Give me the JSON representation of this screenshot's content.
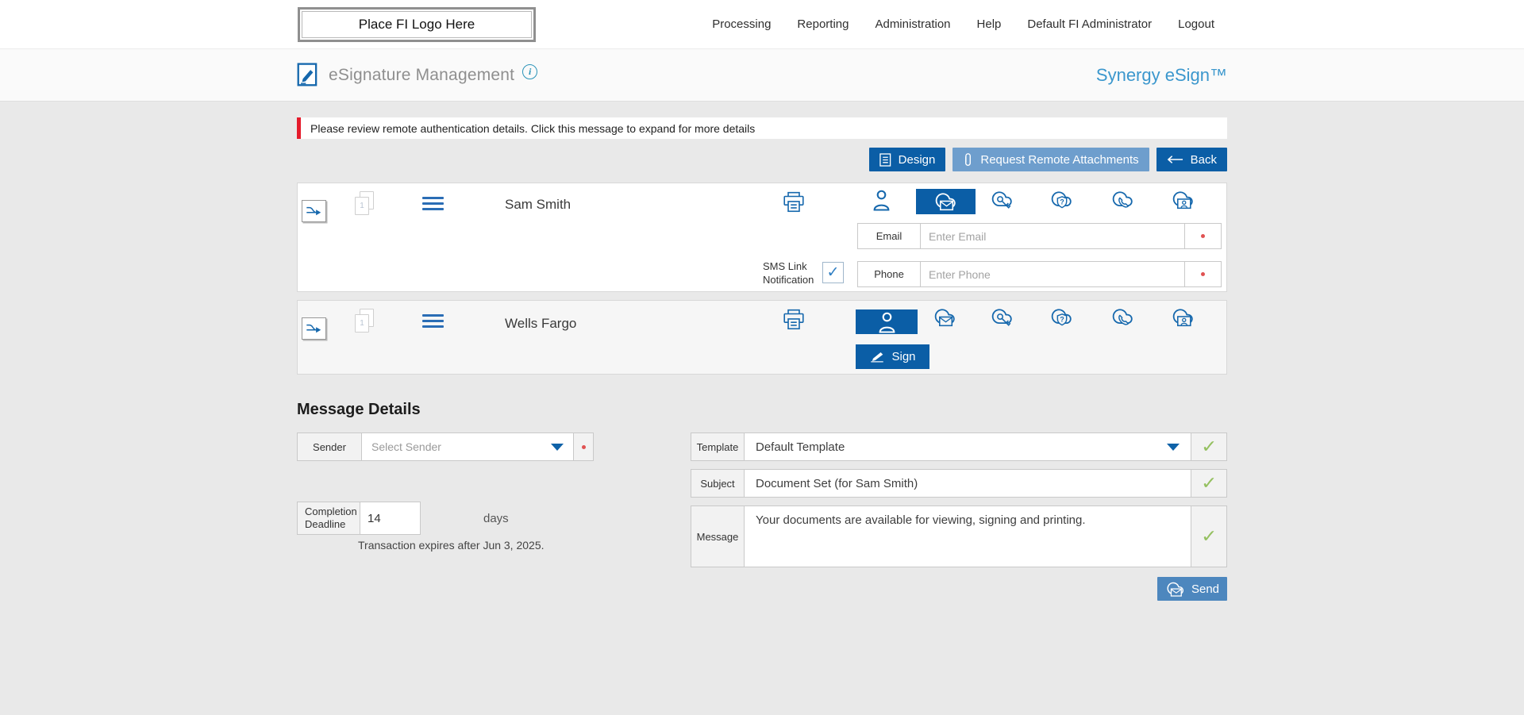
{
  "topnav": {
    "logo_text": "Place FI Logo Here",
    "items": [
      "Processing",
      "Reporting",
      "Administration",
      "Help",
      "Default FI Administrator",
      "Logout"
    ]
  },
  "header": {
    "title": "eSignature Management",
    "brand": "Synergy eSign™"
  },
  "alert": {
    "text": "Please review remote authentication details. Click this message to expand for more details"
  },
  "toolbar": {
    "design_label": "Design",
    "request_label": "Request Remote Attachments",
    "back_label": "Back"
  },
  "signers": [
    {
      "name": "Sam Smith",
      "doc_count": "1",
      "email_label": "Email",
      "email_placeholder": "Enter Email",
      "phone_label": "Phone",
      "phone_placeholder": "Enter Phone",
      "sms_label_line1": "SMS Link",
      "sms_label_line2": "Notification",
      "sms_checked": "✓"
    },
    {
      "name": "Wells Fargo",
      "doc_count": "1",
      "sign_label": "Sign"
    }
  ],
  "message_details": {
    "heading": "Message Details",
    "sender_label": "Sender",
    "sender_placeholder": "Select Sender",
    "completion_label_line1": "Completion",
    "completion_label_line2": "Deadline",
    "completion_value": "14",
    "completion_unit": "days",
    "expiry_note": "Transaction expires after Jun 3, 2025.",
    "template_label": "Template",
    "template_value": "Default Template",
    "subject_label": "Subject",
    "subject_value": "Document Set (for Sam Smith)",
    "message_label": "Message",
    "message_value": "Your documents are available for viewing, signing and printing.",
    "send_label": "Send",
    "check_mark": "✓"
  },
  "colors": {
    "primary_blue": "#0b5ea6",
    "light_blue": "#6e9ecd",
    "send_blue": "#4d87be",
    "brand_blue": "#3b97cd",
    "icon_blue": "#1668ad",
    "alert_red": "#e51c2c",
    "check_green": "#94c05f"
  }
}
